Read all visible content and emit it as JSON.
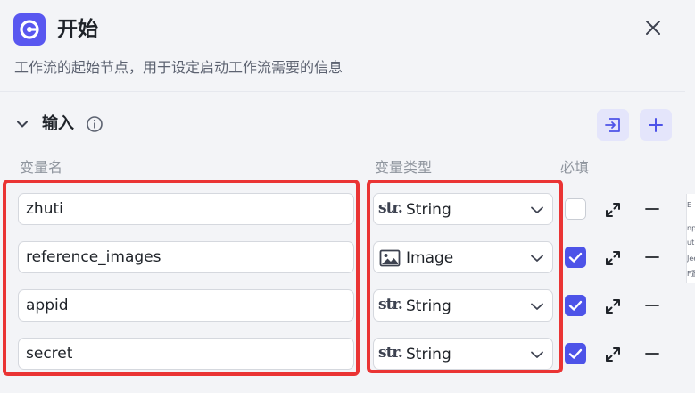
{
  "header": {
    "title": "开始",
    "description": "工作流的起始节点，用于设定启动工作流需要的信息",
    "icon": "start-node-icon",
    "accent": "#5957f0"
  },
  "section": {
    "title": "输入"
  },
  "columns": {
    "name": "变量名",
    "type": "变量类型",
    "required": "必填"
  },
  "rows": [
    {
      "name": "zhuti",
      "type_label": "String",
      "type_icon": "str-icon",
      "required": false
    },
    {
      "name": "reference_images",
      "type_label": "Image",
      "type_icon": "image-icon",
      "required": true
    },
    {
      "name": "appid",
      "type_label": "String",
      "type_icon": "str-icon",
      "required": true
    },
    {
      "name": "secret",
      "type_label": "String",
      "type_icon": "str-icon",
      "required": true
    }
  ],
  "str_glyph": "str.",
  "side_fragment": [
    "E",
    "np",
    "ut",
    "Jee",
    "F置"
  ],
  "colors": {
    "checkbox_on": "#4d53e8",
    "highlight": "#ea3434",
    "icon_button_bg": "#e4e5fb"
  }
}
